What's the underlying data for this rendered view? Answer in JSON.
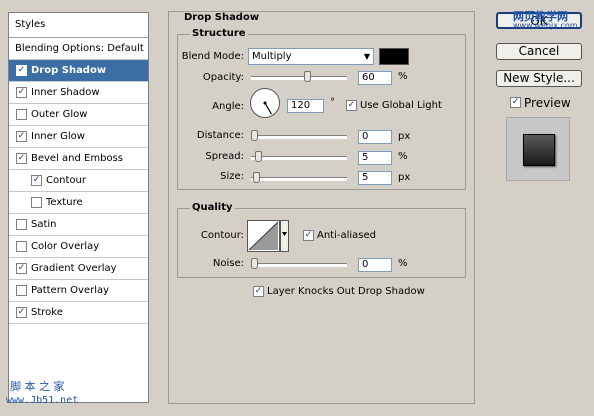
{
  "styles_list": {
    "header": "Styles",
    "items": [
      {
        "label": "Blending Options: Default",
        "checkbox": false,
        "checked": false,
        "sub": false,
        "selected": false
      },
      {
        "label": "Drop Shadow",
        "checkbox": true,
        "checked": true,
        "sub": false,
        "selected": true
      },
      {
        "label": "Inner Shadow",
        "checkbox": true,
        "checked": true,
        "sub": false,
        "selected": false
      },
      {
        "label": "Outer Glow",
        "checkbox": true,
        "checked": false,
        "sub": false,
        "selected": false
      },
      {
        "label": "Inner Glow",
        "checkbox": true,
        "checked": true,
        "sub": false,
        "selected": false
      },
      {
        "label": "Bevel and Emboss",
        "checkbox": true,
        "checked": true,
        "sub": false,
        "selected": false
      },
      {
        "label": "Contour",
        "checkbox": true,
        "checked": true,
        "sub": true,
        "selected": false
      },
      {
        "label": "Texture",
        "checkbox": true,
        "checked": false,
        "sub": true,
        "selected": false
      },
      {
        "label": "Satin",
        "checkbox": true,
        "checked": false,
        "sub": false,
        "selected": false
      },
      {
        "label": "Color Overlay",
        "checkbox": true,
        "checked": false,
        "sub": false,
        "selected": false
      },
      {
        "label": "Gradient Overlay",
        "checkbox": true,
        "checked": true,
        "sub": false,
        "selected": false
      },
      {
        "label": "Pattern Overlay",
        "checkbox": true,
        "checked": false,
        "sub": false,
        "selected": false
      },
      {
        "label": "Stroke",
        "checkbox": true,
        "checked": true,
        "sub": false,
        "selected": false
      }
    ]
  },
  "drop_shadow": {
    "title": "Drop Shadow",
    "structure_title": "Structure",
    "blend_mode_label": "Blend Mode:",
    "blend_mode_value": "Multiply",
    "shadow_color": "#000000",
    "opacity_label": "Opacity:",
    "opacity_value": "60",
    "percent_unit": "%",
    "angle_label": "Angle:",
    "angle_value": "120",
    "degree_unit": "°",
    "use_global_light_label": "Use Global Light",
    "use_global_light_checked": true,
    "distance_label": "Distance:",
    "distance_value": "0",
    "px_unit": "px",
    "spread_label": "Spread:",
    "spread_value": "5",
    "size_label": "Size:",
    "size_value": "5",
    "quality_title": "Quality",
    "contour_label": "Contour:",
    "anti_aliased_label": "Anti-aliased",
    "anti_aliased_checked": true,
    "noise_label": "Noise:",
    "noise_value": "0",
    "layer_knocks_label": "Layer Knocks Out Drop Shadow",
    "layer_knocks_checked": true
  },
  "buttons": {
    "ok_label": "OK",
    "cancel_label": "Cancel",
    "new_style_label": "New Style...",
    "preview_label": "Preview",
    "preview_checked": true
  },
  "watermark": {
    "top_cn": "网页教学网",
    "top_url": "www.webjx.com",
    "bottom_cn": "脚 本 之 家",
    "bottom_url": "www.Jb51.net"
  }
}
